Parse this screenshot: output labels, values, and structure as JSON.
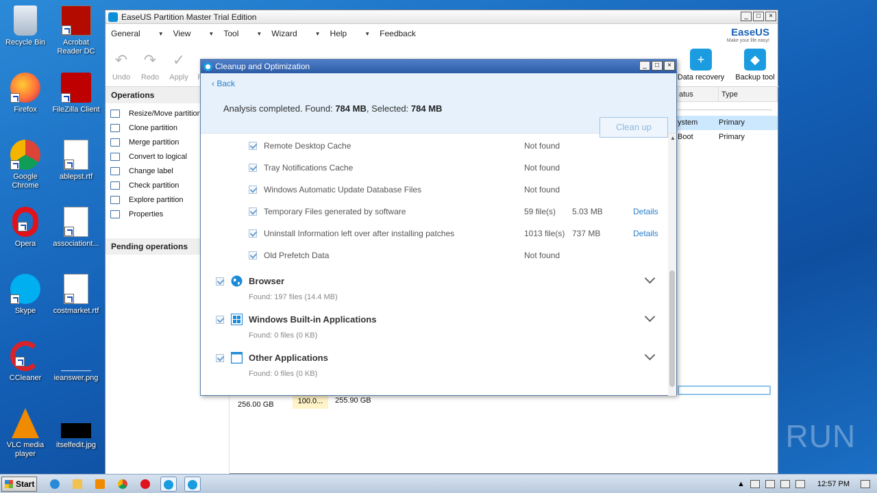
{
  "desktop": {
    "icons": [
      {
        "label": "Recycle Bin"
      },
      {
        "label": "Acrobat Reader DC"
      },
      {
        "label": "Firefox"
      },
      {
        "label": "FileZilla Client"
      },
      {
        "label": "Google Chrome"
      },
      {
        "label": "ablepst.rtf"
      },
      {
        "label": "Opera"
      },
      {
        "label": "associationt..."
      },
      {
        "label": "Skype"
      },
      {
        "label": "costmarket.rtf"
      },
      {
        "label": "CCleaner"
      },
      {
        "label": "ieanswer.png"
      },
      {
        "label": "VLC media player"
      },
      {
        "label": "itselfedit.jpg"
      }
    ]
  },
  "app": {
    "title": "EaseUS Partition Master Trial Edition",
    "menu": [
      "General",
      "View",
      "Tool",
      "Wizard",
      "Help",
      "Feedback"
    ],
    "brand": {
      "name": "EaseUS",
      "tagline": "Make your life easy!"
    },
    "toolbar": {
      "undo": "Undo",
      "redo": "Redo",
      "apply": "Apply",
      "partial": "P"
    },
    "right_tools": {
      "data_recovery": "Data recovery",
      "backup_tool": "Backup tool"
    },
    "operations_header": "Operations",
    "operations": [
      "Resize/Move partition",
      "Clone partition",
      "Merge partition",
      "Convert to logical",
      "Change label",
      "Check partition",
      "Explore partition",
      "Properties"
    ],
    "pending_header": "Pending operations",
    "table": {
      "headers": {
        "status": "atus",
        "type": "Type"
      },
      "rows": [
        {
          "status": "ystem",
          "type": "Primary"
        },
        {
          "status": "Boot",
          "type": "Primary"
        }
      ]
    },
    "disk": {
      "size": "256.00 GB",
      "used": "100.0...",
      "capacity": "255.90 GB"
    }
  },
  "dialog": {
    "title": "Cleanup and Optimization",
    "back": "Back",
    "analysis_prefix": "Analysis completed. Found: ",
    "found": "784 MB",
    "selected_prefix": ", Selected: ",
    "selected": "784 MB",
    "cleanup_button": "Clean up",
    "items": [
      {
        "name": "Remote Desktop Cache",
        "status": "Not found"
      },
      {
        "name": "Tray Notifications Cache",
        "status": "Not found"
      },
      {
        "name": "Windows Automatic Update Database Files",
        "status": "Not found"
      },
      {
        "name": "Temporary Files generated by software",
        "files": "59 file(s)",
        "size": "5.03 MB",
        "details": "Details"
      },
      {
        "name": "Uninstall Information left over after installing patches",
        "files": "1013 file(s)",
        "size": "737 MB",
        "details": "Details"
      },
      {
        "name": "Old Prefetch Data",
        "status": "Not found"
      }
    ],
    "groups": [
      {
        "name": "Browser",
        "summary": "Found: 197 files (14.4 MB)",
        "icon": "globe-icon"
      },
      {
        "name": "Windows Built-in Applications",
        "summary": "Found: 0 files (0 KB)",
        "icon": "windows-icon"
      },
      {
        "name": "Other Applications",
        "summary": "Found: 0 files (0 KB)",
        "icon": "window-icon"
      }
    ]
  },
  "taskbar": {
    "start": "Start",
    "clock": "12:57 PM"
  },
  "watermark": "ANY RUN",
  "colors": {
    "accent": "#1b9ce0",
    "link": "#2a7ec9",
    "dialog_header_bg": "#e6f1fb"
  }
}
